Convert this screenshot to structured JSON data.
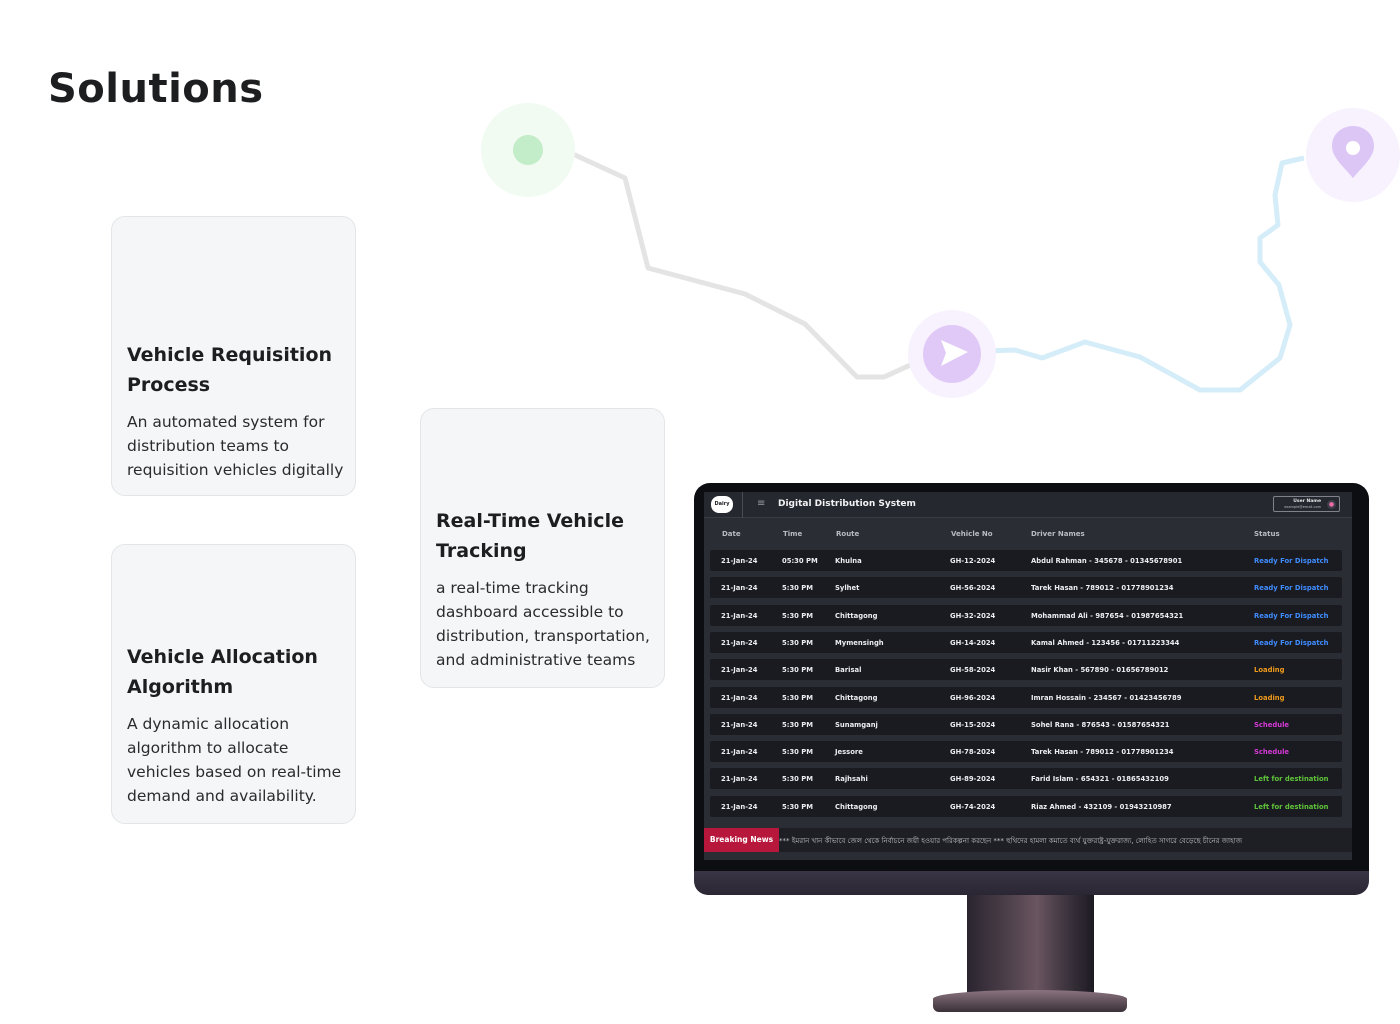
{
  "page": {
    "title": "Solutions"
  },
  "cards": [
    {
      "title": "Vehicle Requisition Process",
      "description": "An automated system for distribution teams to requisition vehicles digitally"
    },
    {
      "title": "Vehicle Allocation Algorithm",
      "description": "A dynamic allocation algorithm to allocate vehicles based on real-time demand and availability."
    },
    {
      "title": "Real-Time Vehicle Tracking",
      "description": "a real-time tracking dashboard accessible to distribution, transportation, and administrative teams"
    }
  ],
  "route_map": {
    "start_icon": "start-dot-icon",
    "mid_icon": "play-icon",
    "end_icon": "location-pin-icon",
    "colors": {
      "past_path": "#e3e3e3",
      "future_path": "#d3ecf7",
      "start": "#bdebc4",
      "mid": "#dcc6f6",
      "end": "#dcc6f6"
    }
  },
  "dashboard": {
    "logo_text": "Dairy",
    "menu_icon": "hamburger-icon",
    "title": "Digital Distribution System",
    "user": {
      "name": "User Name",
      "email": "example@email.com",
      "avatar_icon": "user-icon"
    },
    "columns": [
      "Date",
      "Time",
      "Route",
      "Vehicle No",
      "Driver Names",
      "Status"
    ],
    "rows": [
      {
        "date": "21-Jan-24",
        "time": "05:30 PM",
        "route": "Khulna",
        "vehicle": "GH-12-2024",
        "driver": "Abdul Rahman - 345678 - 01345678901",
        "status": "Ready For Dispatch"
      },
      {
        "date": "21-Jan-24",
        "time": "5:30 PM",
        "route": "Sylhet",
        "vehicle": "GH-56-2024",
        "driver": "Tarek Hasan - 789012 - 01778901234",
        "status": "Ready For Dispatch"
      },
      {
        "date": "21-Jan-24",
        "time": "5:30 PM",
        "route": "Chittagong",
        "vehicle": "GH-32-2024",
        "driver": "Mohammad Ali - 987654 - 01987654321",
        "status": "Ready For Dispatch"
      },
      {
        "date": "21-Jan-24",
        "time": "5:30 PM",
        "route": "Mymensingh",
        "vehicle": "GH-14-2024",
        "driver": "Kamal Ahmed - 123456 - 01711223344",
        "status": "Ready For Dispatch"
      },
      {
        "date": "21-Jan-24",
        "time": "5:30 PM",
        "route": "Barisal",
        "vehicle": "GH-58-2024",
        "driver": "Nasir Khan - 567890 - 01656789012",
        "status": "Loading"
      },
      {
        "date": "21-Jan-24",
        "time": "5:30 PM",
        "route": "Chittagong",
        "vehicle": "GH-96-2024",
        "driver": "Imran Hossain - 234567 - 01423456789",
        "status": "Loading"
      },
      {
        "date": "21-Jan-24",
        "time": "5:30 PM",
        "route": "Sunamganj",
        "vehicle": "GH-15-2024",
        "driver": "Sohel Rana - 876543 - 01587654321",
        "status": "Schedule"
      },
      {
        "date": "21-Jan-24",
        "time": "5:30 PM",
        "route": "Jessore",
        "vehicle": "GH-78-2024",
        "driver": "Tarek Hasan - 789012 - 01778901234",
        "status": "Schedule"
      },
      {
        "date": "21-Jan-24",
        "time": "5:30 PM",
        "route": "Rajhsahi",
        "vehicle": "GH-89-2024",
        "driver": "Farid Islam - 654321 - 01865432109",
        "status": "Left for destination"
      },
      {
        "date": "21-Jan-24",
        "time": "5:30 PM",
        "route": "Chittagong",
        "vehicle": "GH-74-2024",
        "driver": "Riaz Ahmed - 432109 - 01943210987",
        "status": "Left for destination"
      }
    ],
    "status_colors": {
      "Ready For Dispatch": "#3f8cff",
      "Loading": "#f09a1c",
      "Schedule": "#d63ad8",
      "Left for destination": "#5fc43a"
    },
    "ticker": {
      "label": "Breaking News",
      "text": "*** ইমরান খান কীভাবে জেল থেকে নির্বাচনে জয়ী হওয়ার পরিকল্পনা করছেন      *** হুথিদের হামলা কমাতে ব্যর্থ যুক্তরাষ্ট্র-যুক্তরাজ্য, লোহিত সাগরে বেড়েছে চীনের জাহাজ"
    }
  }
}
